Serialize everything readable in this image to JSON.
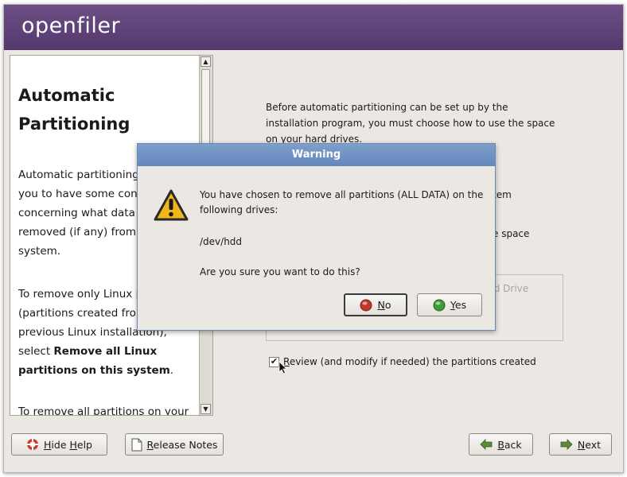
{
  "app": {
    "logo": "openfiler"
  },
  "help": {
    "title": "Automatic Partitioning",
    "p1": "Automatic partitioning allows you to have some control concerning what data is removed (if any) from your system.",
    "p2_before": "To remove only Linux partitions (partitions created from a previous Linux installation), select ",
    "p2_bold": "Remove all Linux partitions on this system",
    "p2_after": ".",
    "p3": "To remove all partitions on your hard drive(s) (this includes"
  },
  "main": {
    "intro": "Before automatic partitioning can be set up by the installation program, you must choose how to use the space on your hard drives.",
    "frag_tem": "tem",
    "frag_space": "e space",
    "frag_drive": "rd Drive",
    "review_prefix": "R",
    "review_rest": "eview (and modify if needed) the partitions created",
    "review_checked": "✔"
  },
  "buttons": {
    "hide_help_u": "H",
    "hide_help": "ide ",
    "hide_help_u2": "H",
    "hide_help_end": "elp",
    "release_u": "R",
    "release_rest": "elease Notes",
    "back_u": "B",
    "back_rest": "ack",
    "next_u": "N",
    "next_rest": "ext"
  },
  "dialog": {
    "title": "Warning",
    "message": "You have chosen to remove all partitions (ALL DATA) on the following drives:",
    "device": "/dev/hdd",
    "question": "Are you sure you want to do this?",
    "no_u": "N",
    "no_rest": "o",
    "yes_u": "Y",
    "yes_rest": "es"
  },
  "colors": {
    "banner": "#5e4278",
    "dialog_title": "#6f91c4",
    "warning_icon": "#f2b51e",
    "no_icon": "#c0392b",
    "yes_icon": "#3f9a3a"
  },
  "icons": {
    "warning": "warning-icon",
    "no": "no-icon",
    "yes": "yes-icon",
    "hide_help": "lifebuoy-icon",
    "release": "document-icon",
    "back": "arrow-left-icon",
    "next": "arrow-right-icon"
  }
}
